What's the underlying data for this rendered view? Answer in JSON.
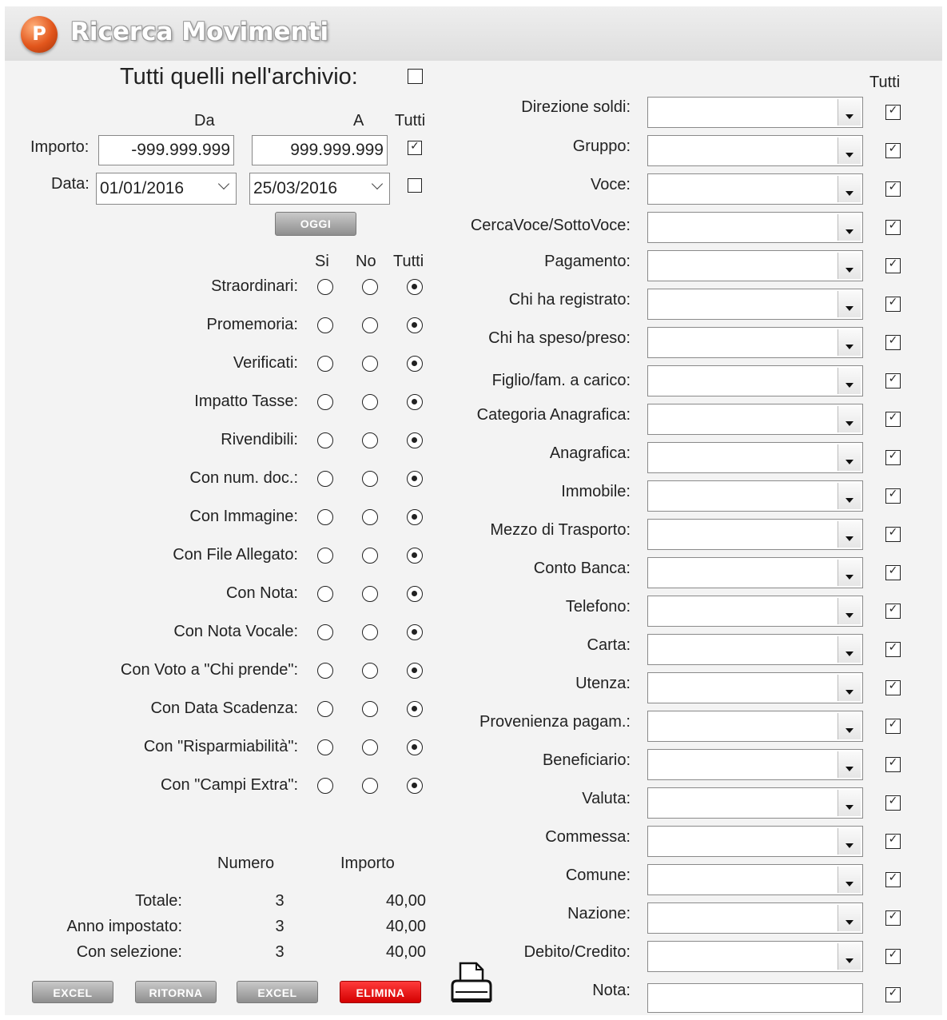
{
  "window": {
    "title": "Ricerca Movimenti",
    "logo_letter": "P"
  },
  "archive": {
    "label": "Tutti quelli nell'archivio:",
    "checked": false
  },
  "range": {
    "header_da": "Da",
    "header_a": "A",
    "header_tutti": "Tutti",
    "importo_label": "Importo:",
    "importo_da": "-999.999.999",
    "importo_a": "999.999.999",
    "importo_tutti": true,
    "data_label": "Data:",
    "data_da": "01/01/2016",
    "data_a": "25/03/2016",
    "data_tutti": false,
    "oggi_label": "OGGI"
  },
  "filters": {
    "header_si": "Si",
    "header_no": "No",
    "header_tutti": "Tutti",
    "rows": [
      {
        "label": "Straordinari:",
        "value": "tutti"
      },
      {
        "label": "Promemoria:",
        "value": "tutti"
      },
      {
        "label": "Verificati:",
        "value": "tutti"
      },
      {
        "label": "Impatto Tasse:",
        "value": "tutti"
      },
      {
        "label": "Rivendibili:",
        "value": "tutti"
      },
      {
        "label": "Con num. doc.:",
        "value": "tutti"
      },
      {
        "label": "Con Immagine:",
        "value": "tutti"
      },
      {
        "label": "Con File Allegato:",
        "value": "tutti"
      },
      {
        "label": "Con Nota:",
        "value": "tutti"
      },
      {
        "label": "Con Nota Vocale:",
        "value": "tutti"
      },
      {
        "label": "Con Voto a \"Chi prende\":",
        "value": "tutti"
      },
      {
        "label": "Con Data Scadenza:",
        "value": "tutti"
      },
      {
        "label": "Con \"Risparmiabilità\":",
        "value": "tutti"
      },
      {
        "label": "Con \"Campi Extra\":",
        "value": "tutti"
      }
    ]
  },
  "summary": {
    "header_numero": "Numero",
    "header_importo": "Importo",
    "rows": [
      {
        "label": "Totale:",
        "numero": "3",
        "importo": "40,00"
      },
      {
        "label": "Anno impostato:",
        "numero": "3",
        "importo": "40,00"
      },
      {
        "label": "Con selezione:",
        "numero": "3",
        "importo": "40,00"
      }
    ]
  },
  "buttons": {
    "excel1": "EXCEL",
    "ritorna": "RITORNA",
    "excel2": "EXCEL",
    "elimina": "ELIMINA"
  },
  "right": {
    "header_tutti": "Tutti",
    "fields": [
      {
        "label": "Direzione soldi:",
        "type": "combo",
        "value": "",
        "tutti": true
      },
      {
        "label": "Gruppo:",
        "type": "combo",
        "value": "",
        "tutti": true
      },
      {
        "label": "Voce:",
        "type": "combo",
        "value": "",
        "tutti": true
      },
      {
        "label": "CercaVoce/SottoVoce:",
        "type": "combo",
        "value": "",
        "tutti": true
      },
      {
        "label": "Pagamento:",
        "type": "combo",
        "value": "",
        "tutti": true
      },
      {
        "label": "Chi ha registrato:",
        "type": "combo",
        "value": "",
        "tutti": true
      },
      {
        "label": "Chi ha speso/preso:",
        "type": "combo",
        "value": "",
        "tutti": true
      },
      {
        "label": "Figlio/fam. a carico:",
        "type": "combo",
        "value": "",
        "tutti": true
      },
      {
        "label": "Categoria Anagrafica:",
        "type": "combo",
        "value": "",
        "tutti": true
      },
      {
        "label": "Anagrafica:",
        "type": "combo",
        "value": "",
        "tutti": true
      },
      {
        "label": "Immobile:",
        "type": "combo",
        "value": "",
        "tutti": true
      },
      {
        "label": "Mezzo di Trasporto:",
        "type": "combo",
        "value": "",
        "tutti": true
      },
      {
        "label": "Conto Banca:",
        "type": "combo",
        "value": "",
        "tutti": true
      },
      {
        "label": "Telefono:",
        "type": "combo",
        "value": "",
        "tutti": true
      },
      {
        "label": "Carta:",
        "type": "combo",
        "value": "",
        "tutti": true
      },
      {
        "label": "Utenza:",
        "type": "combo",
        "value": "",
        "tutti": true
      },
      {
        "label": "Provenienza pagam.:",
        "type": "combo",
        "value": "",
        "tutti": true
      },
      {
        "label": "Beneficiario:",
        "type": "combo",
        "value": "",
        "tutti": true
      },
      {
        "label": "Valuta:",
        "type": "combo",
        "value": "",
        "tutti": true
      },
      {
        "label": "Commessa:",
        "type": "combo",
        "value": "",
        "tutti": true
      },
      {
        "label": "Comune:",
        "type": "combo",
        "value": "",
        "tutti": true
      },
      {
        "label": "Nazione:",
        "type": "combo",
        "value": "",
        "tutti": true
      },
      {
        "label": "Debito/Credito:",
        "type": "combo",
        "value": "",
        "tutti": true
      },
      {
        "label": "Nota:",
        "type": "text",
        "value": "",
        "tutti": true
      }
    ]
  },
  "icons": {
    "print": "printer-icon",
    "logo": "app-logo-icon"
  }
}
